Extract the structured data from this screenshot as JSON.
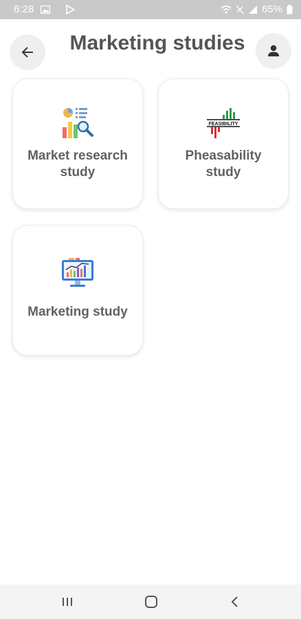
{
  "status_bar": {
    "time": "6:28",
    "battery": "65%"
  },
  "header": {
    "title": "Marketing studies",
    "back_icon": "arrow-left-icon",
    "profile_icon": "person-icon"
  },
  "cards": [
    {
      "label_line1": "Market research",
      "label_line2": "study",
      "icon": "market-research-icon"
    },
    {
      "label_line1": "Pheasability",
      "label_line2": "study",
      "icon": "feasibility-icon",
      "icon_text": "FEASIBILITY"
    },
    {
      "label_line1": "Marketing study",
      "icon": "marketing-monitor-icon"
    }
  ],
  "nav_bar": {
    "recents_icon": "recents-icon",
    "home_icon": "home-icon",
    "back_icon": "back-chevron-icon"
  },
  "colors": {
    "status_bar": "#c9c9c9",
    "title": "#555555",
    "card_label": "#616161",
    "button_bg": "#efefef",
    "nav_bar": "#f4f4f4"
  }
}
